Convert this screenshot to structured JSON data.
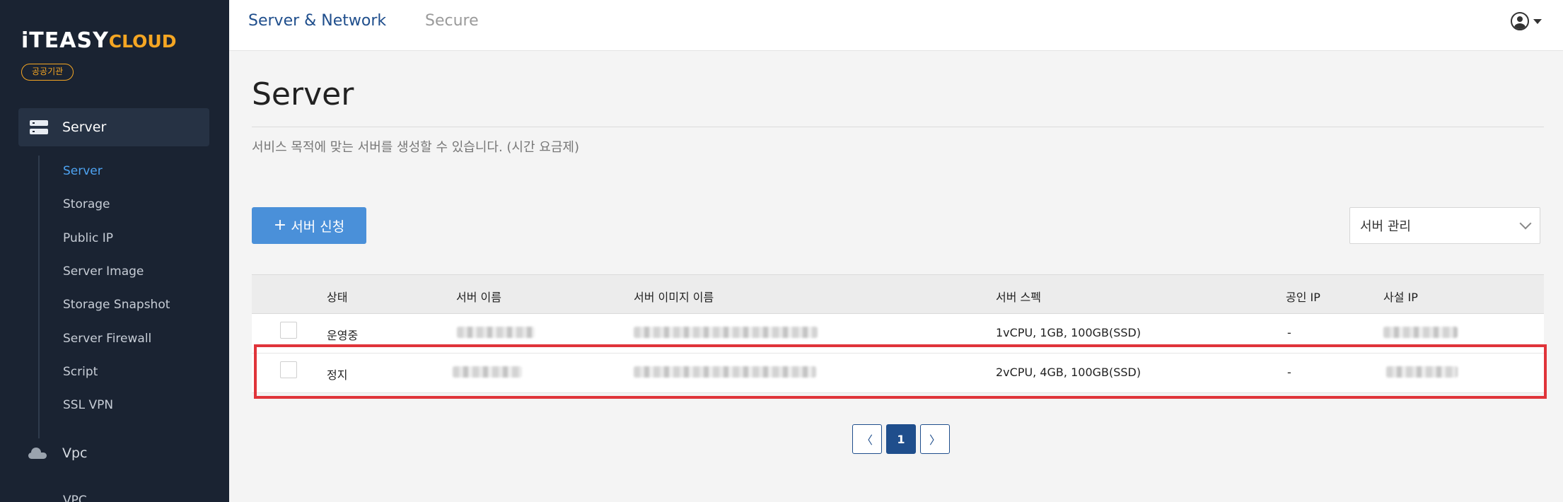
{
  "sidebar": {
    "logo_main": "iTEASY",
    "logo_cloud": "CLOUD",
    "badge": "공공기관",
    "group_server": "Server",
    "items": [
      {
        "label": "Server"
      },
      {
        "label": "Storage"
      },
      {
        "label": "Public IP"
      },
      {
        "label": "Server Image"
      },
      {
        "label": "Storage Snapshot"
      },
      {
        "label": "Server Firewall"
      },
      {
        "label": "Script"
      },
      {
        "label": "SSL VPN"
      }
    ],
    "group_vpc": "Vpc",
    "vpc_sub": "VPC"
  },
  "header": {
    "tabs": [
      {
        "label": "Server & Network"
      },
      {
        "label": "Secure"
      }
    ]
  },
  "main": {
    "title": "Server",
    "description": "서비스 목적에 맞는 서버를 생성할 수 있습니다. (시간 요금제)",
    "create_button": "서버 신청",
    "create_plus": "+",
    "manage_select": "서버 관리"
  },
  "table": {
    "headers": [
      "상태",
      "서버 이름",
      "서버 이미지 이름",
      "서버 스펙",
      "공인 IP",
      "사설 IP"
    ],
    "rows": [
      {
        "status": "운영중",
        "spec": "1vCPU, 1GB, 100GB(SSD)",
        "public_ip": "-"
      },
      {
        "status": "정지",
        "spec": "2vCPU, 4GB, 100GB(SSD)",
        "public_ip": "-"
      }
    ]
  },
  "pagination": {
    "prev": "〈",
    "current": "1",
    "next": "〉"
  },
  "colors": {
    "sidebar_bg": "#1a2332",
    "accent_blue": "#4a90d9",
    "active_tab": "#1f4e8c",
    "highlight_red": "#e0343a",
    "badge_orange": "#f5a623"
  }
}
